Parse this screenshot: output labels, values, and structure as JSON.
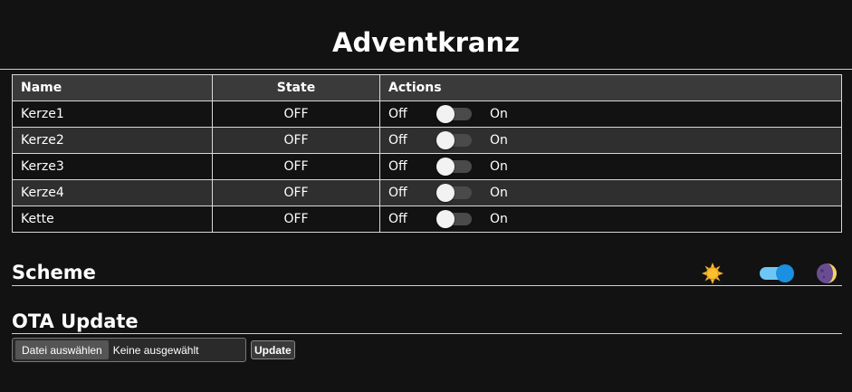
{
  "title": "Adventkranz",
  "table": {
    "headers": {
      "name": "Name",
      "state": "State",
      "actions": "Actions"
    },
    "rows": [
      {
        "name": "Kerze1",
        "state": "OFF",
        "off_label": "Off",
        "on_label": "On",
        "toggle_on": false
      },
      {
        "name": "Kerze2",
        "state": "OFF",
        "off_label": "Off",
        "on_label": "On",
        "toggle_on": false
      },
      {
        "name": "Kerze3",
        "state": "OFF",
        "off_label": "Off",
        "on_label": "On",
        "toggle_on": false
      },
      {
        "name": "Kerze4",
        "state": "OFF",
        "off_label": "Off",
        "on_label": "On",
        "toggle_on": false
      },
      {
        "name": "Kette",
        "state": "OFF",
        "off_label": "Off",
        "on_label": "On",
        "toggle_on": false
      }
    ]
  },
  "scheme": {
    "heading": "Scheme",
    "light_icon": "sun-icon",
    "dark_icon": "moon-icon",
    "toggle_on": true,
    "accent_color": "#1b8fe0"
  },
  "ota": {
    "heading": "OTA Update",
    "file_button_label": "Datei auswählen",
    "file_status": "Keine ausgewählt",
    "update_button_label": "Update"
  },
  "colors": {
    "background": "#121212",
    "header_row": "#3a3a3a",
    "alt_row": "#2f2f2f"
  }
}
